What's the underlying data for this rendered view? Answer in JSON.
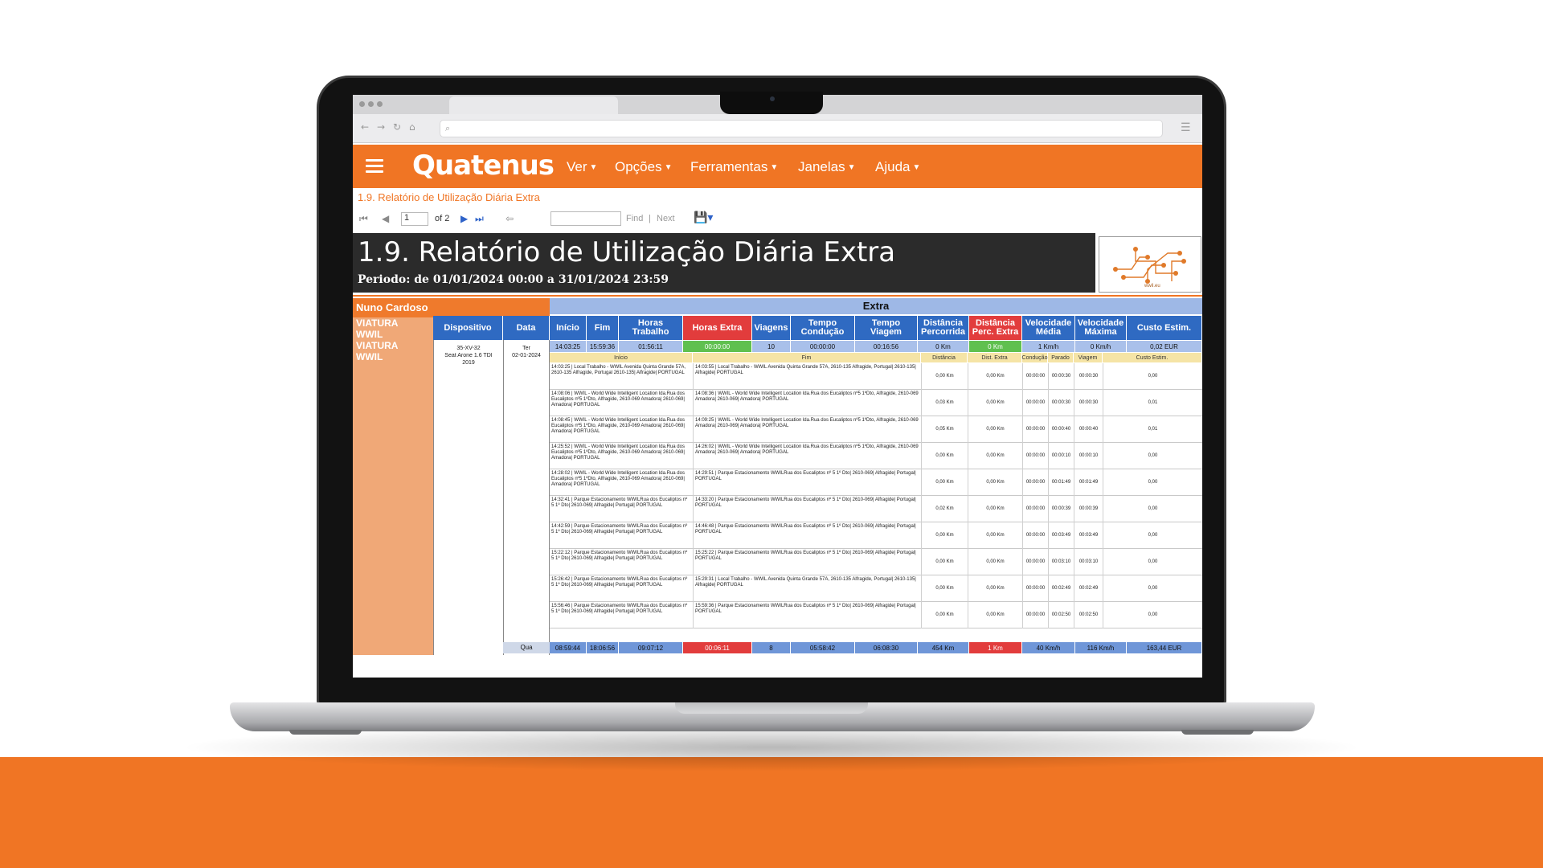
{
  "app": {
    "logo": "Quatenus",
    "nav": [
      "Ver",
      "Opções",
      "Ferramentas",
      "Janelas",
      "Ajuda"
    ]
  },
  "breadcrumb": "1.9. Relatório de Utilização Diária Extra",
  "report_toolbar": {
    "page_value": "1",
    "of_pages": "of 2",
    "find_label": "Find",
    "separator": "|",
    "next_label": "Next"
  },
  "report": {
    "title": "1.9. Relatório de Utilização Diária Extra",
    "period": "Periodo: de 01/01/2024 00:00 a 31/01/2024 23:59",
    "logo_text": "wwil.eu",
    "driver": "Nuno Cardoso",
    "vehicle_labels": [
      "VIATURA",
      "WWIL",
      "VIATURA",
      "WWIL"
    ],
    "device": "35-XV-32\nSeat Arone 1.6 TDI\n2019",
    "date_1": "Ter\n02-01-2024",
    "group_header": "Extra",
    "columns": [
      "Dispositivo",
      "Data",
      "Início",
      "Fim",
      "Horas Trabalho",
      "Horas Extra",
      "Viagens",
      "Tempo Condução",
      "Tempo Viagem",
      "Distância Percorrida",
      "Distância Perc. Extra",
      "Velocidade Média",
      "Velocidade Máxima",
      "Custo Estim."
    ],
    "summary_1": [
      "14:03:25",
      "15:59:36",
      "01:56:11",
      "00:00:00",
      "10",
      "00:00:00",
      "00:16:56",
      "0 Km",
      "0 Km",
      "1 Km/h",
      "0 Km/h",
      "0,02 EUR"
    ],
    "sub_headers": [
      "Início",
      "Fim",
      "Distância",
      "Dist. Extra",
      "Condução",
      "Parado",
      "Viagem",
      "Custo Estim."
    ],
    "details": [
      {
        "start": "14:03:25 | Local Trabalho - WWIL Avenida Quinta Grande 57A, 2610-135 Alfragide, Portugal 2610-135| Alfragide| PORTUGAL",
        "end": "14:03:55 | Local Trabalho - WWIL Avenida Quinta Grande 57A, 2610-135 Alfragide, Portugal| 2610-135| Alfragide| PORTUGAL",
        "dist": "0,00 Km",
        "extra": "0,00 Km",
        "cond": "00:00:00",
        "parado": "00:00:30",
        "viagem": "00:00:30",
        "custo": "0,00"
      },
      {
        "start": "14:08:06 | WWIL - World Wide Intelligent Location lda.Rua dos Eucaliptos nº5 1ºDto, Alfragide, 2610-069 Amadora| 2610-069| Amadora| PORTUGAL",
        "end": "14:08:36 | WWIL - World Wide Intelligent Location lda.Rua dos Eucaliptos nº5 1ºDto, Alfragide, 2610-069 Amadora| 2610-069| Amadora| PORTUGAL",
        "dist": "0,03 Km",
        "extra": "0,00 Km",
        "cond": "00:00:00",
        "parado": "00:00:30",
        "viagem": "00:00:30",
        "custo": "0,01"
      },
      {
        "start": "14:08:45 | WWIL - World Wide Intelligent Location lda.Rua dos Eucaliptos nº5 1ºDto, Alfragide, 2610-069 Amadora| 2610-069| Amadora| PORTUGAL",
        "end": "14:09:25 | WWIL - World Wide Intelligent Location lda.Rua dos Eucaliptos nº5 1ºDto, Alfragide, 2610-069 Amadora| 2610-069| Amadora| PORTUGAL",
        "dist": "0,05 Km",
        "extra": "0,00 Km",
        "cond": "00:00:00",
        "parado": "00:00:40",
        "viagem": "00:00:40",
        "custo": "0,01"
      },
      {
        "start": "14:25:52 | WWIL - World Wide Intelligent Location lda.Rua dos Eucaliptos nº5 1ºDto, Alfragide, 2610-069 Amadora| 2610-069| Amadora| PORTUGAL",
        "end": "14:26:02 | WWIL - World Wide Intelligent Location lda.Rua dos Eucaliptos nº5 1ºDto, Alfragide, 2610-069 Amadora| 2610-069| Amadora| PORTUGAL",
        "dist": "0,00 Km",
        "extra": "0,00 Km",
        "cond": "00:00:00",
        "parado": "00:00:10",
        "viagem": "00:00:10",
        "custo": "0,00"
      },
      {
        "start": "14:28:02 | WWIL - World Wide Intelligent Location lda.Rua dos Eucaliptos nº5 1ºDto, Alfragide, 2610-069 Amadora| 2610-069| Amadora| PORTUGAL",
        "end": "14:29:51 | Parque Estacionamento WWILRua dos Eucaliptos nº 5 1º Dto| 2610-069| Alfragide| Portugal| PORTUGAL",
        "dist": "0,00 Km",
        "extra": "0,00 Km",
        "cond": "00:00:00",
        "parado": "00:01:49",
        "viagem": "00:01:49",
        "custo": "0,00"
      },
      {
        "start": "14:32:41 | Parque Estacionamento WWILRua dos Eucaliptos nº 5 1º Dto| 2610-069| Alfragide| Portugal| PORTUGAL",
        "end": "14:33:20 | Parque Estacionamento WWILRua dos Eucaliptos nº 5 1º Dto| 2610-069| Alfragide| Portugal| PORTUGAL",
        "dist": "0,02 Km",
        "extra": "0,00 Km",
        "cond": "00:00:00",
        "parado": "00:00:39",
        "viagem": "00:00:39",
        "custo": "0,00"
      },
      {
        "start": "14:42:59 | Parque Estacionamento WWILRua dos Eucaliptos nº 5 1º Dto| 2610-069| Alfragide| Portugal| PORTUGAL",
        "end": "14:46:48 | Parque Estacionamento WWILRua dos Eucaliptos nº 5 1º Dto| 2610-069| Alfragide| Portugal| PORTUGAL",
        "dist": "0,00 Km",
        "extra": "0,00 Km",
        "cond": "00:00:00",
        "parado": "00:03:49",
        "viagem": "00:03:49",
        "custo": "0,00"
      },
      {
        "start": "15:22:12 | Parque Estacionamento WWILRua dos Eucaliptos nº 5 1º Dto| 2610-069| Alfragide| Portugal| PORTUGAL",
        "end": "15:25:22 | Parque Estacionamento WWILRua dos Eucaliptos nº 5 1º Dto| 2610-069| Alfragide| Portugal| PORTUGAL",
        "dist": "0,00 Km",
        "extra": "0,00 Km",
        "cond": "00:00:00",
        "parado": "00:03:10",
        "viagem": "00:03:10",
        "custo": "0,00"
      },
      {
        "start": "15:26:42 | Parque Estacionamento WWILRua dos Eucaliptos nº 5 1º Dto| 2610-069| Alfragide| Portugal| PORTUGAL",
        "end": "15:29:31 | Local Trabalho - WWIL Avenida Quinta Grande 57A, 2610-135 Alfragide, Portugal| 2610-135| Alfragide| PORTUGAL",
        "dist": "0,00 Km",
        "extra": "0,00 Km",
        "cond": "00:00:00",
        "parado": "00:02:49",
        "viagem": "00:02:49",
        "custo": "0,00"
      },
      {
        "start": "15:56:46 | Parque Estacionamento WWILRua dos Eucaliptos nº 5 1º Dto| 2610-069| Alfragide| Portugal| PORTUGAL",
        "end": "15:59:36 | Parque Estacionamento WWILRua dos Eucaliptos nº 5 1º Dto| 2610-069| Alfragide| Portugal| PORTUGAL",
        "dist": "0,00 Km",
        "extra": "0,00 Km",
        "cond": "00:00:00",
        "parado": "00:02:50",
        "viagem": "00:02:50",
        "custo": "0,00"
      }
    ],
    "date_2": "Qua",
    "summary_2": [
      "08:59:44",
      "18:06:56",
      "09:07:12",
      "00:06:11",
      "8",
      "05:58:42",
      "06:08:30",
      "454 Km",
      "1 Km",
      "40 Km/h",
      "116 Km/h",
      "163,44 EUR"
    ]
  },
  "colors": {
    "brand_orange": "#f07524",
    "header_blue": "#2f6ac2",
    "alert_red": "#e23c3c",
    "ok_green": "#5fc04f"
  }
}
